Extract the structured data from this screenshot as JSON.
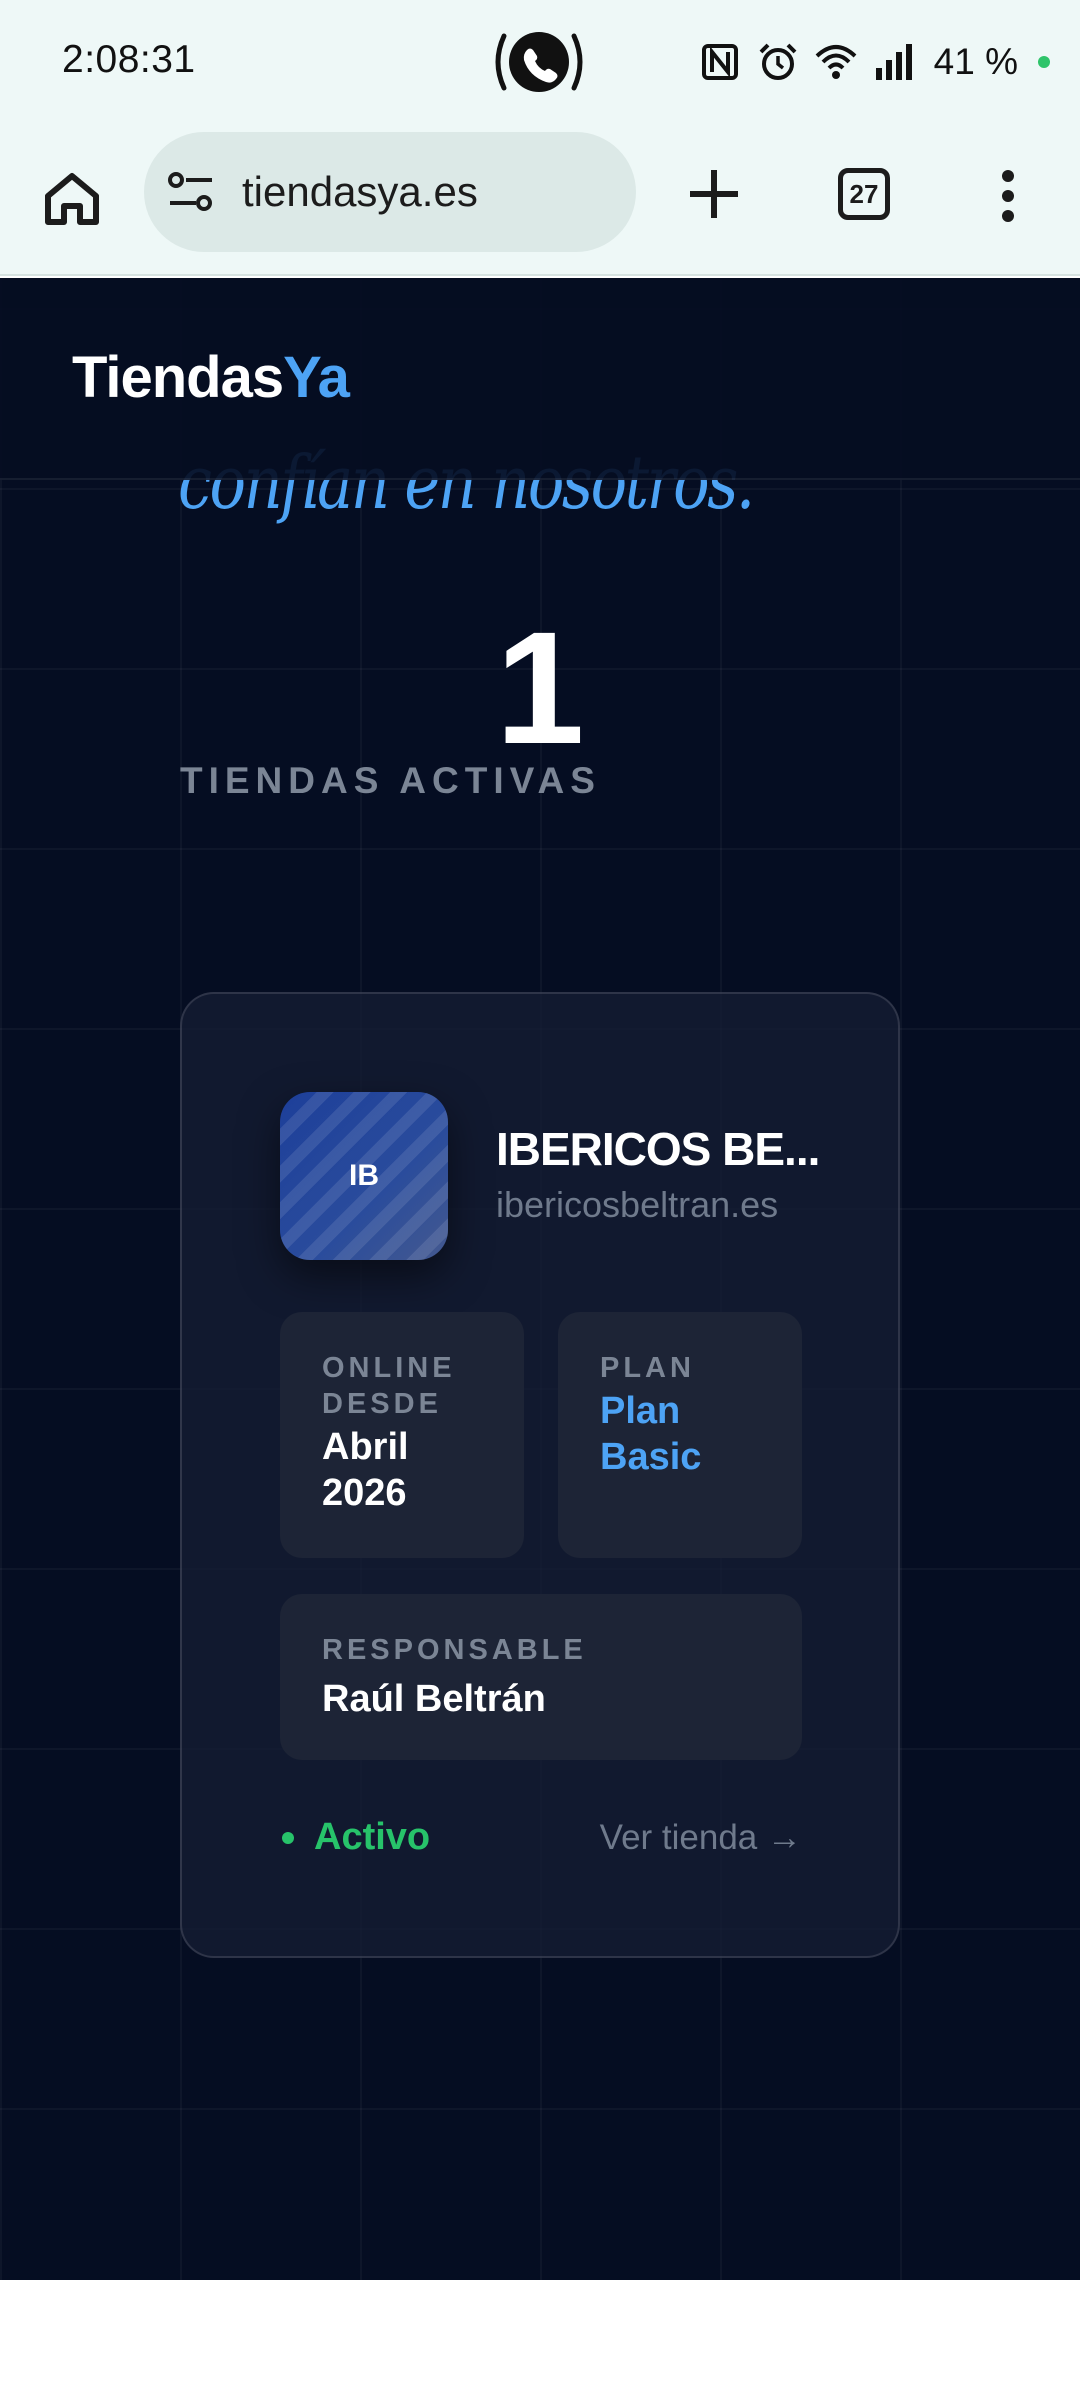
{
  "status_bar": {
    "time": "2:08:31",
    "battery": "41 %",
    "icons": [
      "call-icon",
      "nfc-icon",
      "alarm-icon",
      "wifi-icon",
      "signal-icon"
    ]
  },
  "browser": {
    "url": "tiendasya.es",
    "tab_count": "27"
  },
  "site": {
    "logo_main": "Tiendas",
    "logo_accent": "Ya",
    "script_text": "confían en nosotros."
  },
  "stats": {
    "count": "1",
    "label": "TIENDAS ACTIVAS"
  },
  "store": {
    "initials": "IB",
    "name": "IBERICOS BE...",
    "domain": "ibericosbeltran.es",
    "online_label": "ONLINE DESDE",
    "online_value": "Abril 2026",
    "plan_label": "PLAN",
    "plan_value": "Plan Basic",
    "responsible_label": "RESPONSABLE",
    "responsible_value": "Raúl Beltrán",
    "status": "Activo",
    "view_link": "Ver tienda →"
  },
  "colors": {
    "accent_blue": "#4da3f5",
    "active_green": "#27c36a",
    "page_bg": "#050d22"
  }
}
